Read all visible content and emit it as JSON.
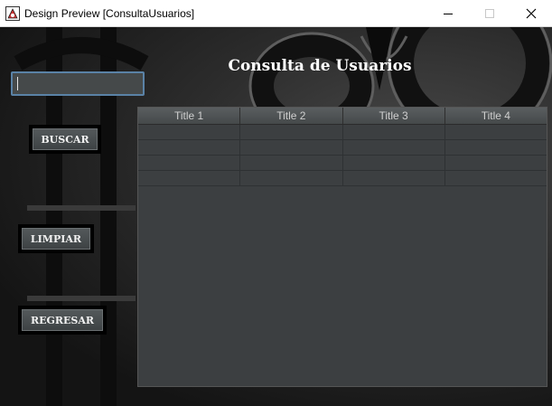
{
  "window": {
    "title": "Design Preview [ConsultaUsuarios]",
    "icon": "java-app-icon",
    "controls": [
      "minimize-icon",
      "maximize-icon",
      "close-icon"
    ]
  },
  "form": {
    "heading": "Consulta de Usuarios",
    "search": {
      "value": "",
      "placeholder": ""
    },
    "buttons": {
      "buscar": "BUSCAR",
      "limpiar": "LIMPIAR",
      "regresar": "REGRESAR"
    }
  },
  "table": {
    "columns": [
      "Title 1",
      "Title 2",
      "Title 3",
      "Title 4"
    ],
    "rows": [
      [
        "",
        "",
        "",
        ""
      ],
      [
        "",
        "",
        "",
        ""
      ],
      [
        "",
        "",
        "",
        ""
      ],
      [
        "",
        "",
        "",
        ""
      ]
    ]
  },
  "colors": {
    "focus_border": "#5a82a6",
    "table_bg": "#3c3f41",
    "heading_text": "#ffffff"
  }
}
